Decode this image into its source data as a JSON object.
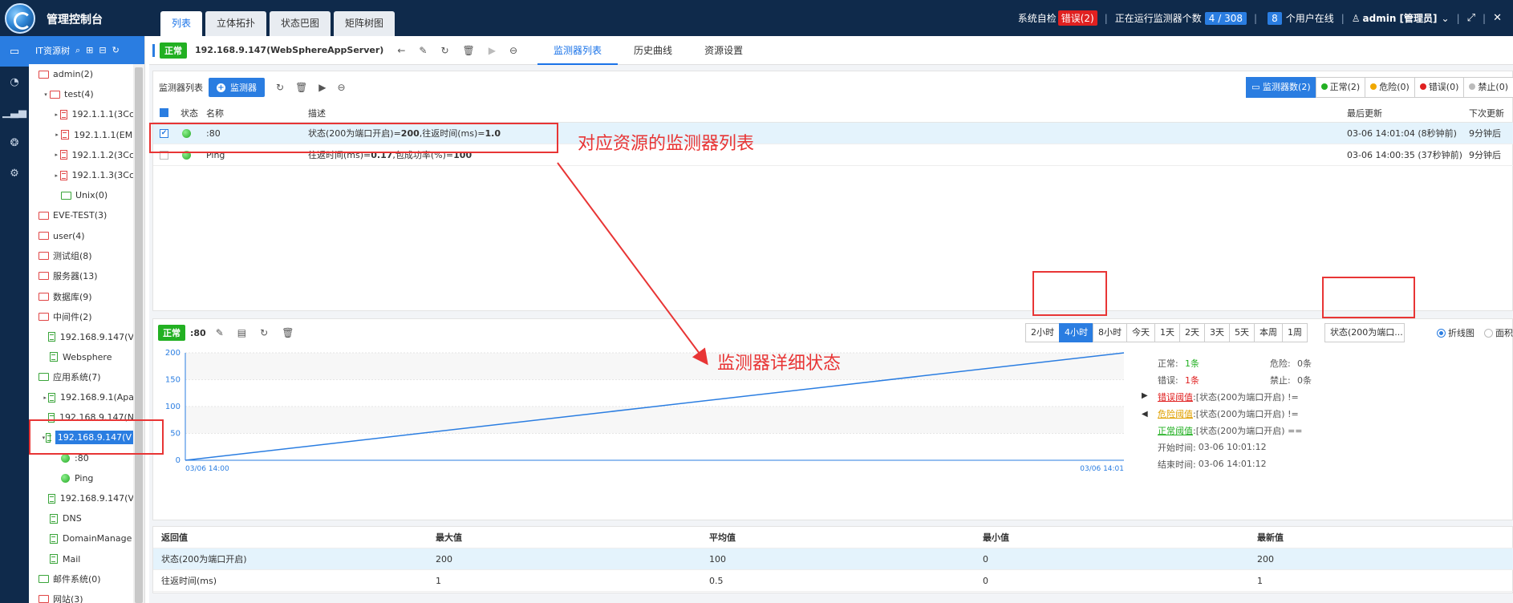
{
  "app": {
    "title": "管理控制台"
  },
  "top_tabs": [
    "列表",
    "立体拓扑",
    "状态巴图",
    "矩阵树图"
  ],
  "header": {
    "self_check_label": "系统自检",
    "self_check_status": "错误(2)",
    "running_label": "正在运行监测器个数",
    "running_count": "4 / 308",
    "online_count": "8",
    "online_label": "个用户在线",
    "user": "admin [管理员]"
  },
  "tree": {
    "header": "IT资源树",
    "nodes": [
      {
        "label": "admin(2)",
        "type": "folder-open",
        "caret": "",
        "indent": 0
      },
      {
        "label": "test(4)",
        "type": "folder-open",
        "caret": "▾",
        "indent": 1
      },
      {
        "label": "192.1.1.1(3Cc",
        "type": "doc",
        "caret": "▸",
        "indent": 2
      },
      {
        "label": "192.1.1.1(EM",
        "type": "doc",
        "caret": "▸",
        "indent": 2
      },
      {
        "label": "192.1.1.2(3Cc",
        "type": "doc",
        "caret": "▸",
        "indent": 2
      },
      {
        "label": "192.1.1.3(3Cc",
        "type": "doc",
        "caret": "▸",
        "indent": 2
      },
      {
        "label": "Unix(0)",
        "type": "folder-green",
        "caret": "",
        "indent": 2
      },
      {
        "label": "EVE-TEST(3)",
        "type": "folder",
        "caret": "",
        "indent": 0
      },
      {
        "label": "user(4)",
        "type": "folder",
        "caret": "",
        "indent": 0
      },
      {
        "label": "测试组(8)",
        "type": "folder",
        "caret": "",
        "indent": 0
      },
      {
        "label": "服务器(13)",
        "type": "folder",
        "caret": "",
        "indent": 0
      },
      {
        "label": "数据库(9)",
        "type": "folder",
        "caret": "",
        "indent": 0
      },
      {
        "label": "中间件(2)",
        "type": "folder-open",
        "caret": "",
        "indent": 0
      },
      {
        "label": "192.168.9.147(V",
        "type": "doc-green",
        "caret": "",
        "indent": 1
      },
      {
        "label": "Websphere",
        "type": "doc-green",
        "caret": "",
        "indent": 1
      },
      {
        "label": "应用系统(7)",
        "type": "folder-green",
        "caret": "",
        "indent": 0
      },
      {
        "label": "192.168.9.1(Apa",
        "type": "doc-green",
        "caret": "▸",
        "indent": 1
      },
      {
        "label": "192.168.9.147(N",
        "type": "doc-green",
        "caret": "",
        "indent": 1
      },
      {
        "label": "192.168.9.147(V",
        "type": "doc-green",
        "caret": "▾",
        "indent": 1,
        "selected": true
      },
      {
        "label": ":80",
        "type": "dot",
        "caret": "",
        "indent": 2
      },
      {
        "label": "Ping",
        "type": "dot",
        "caret": "",
        "indent": 2
      },
      {
        "label": "192.168.9.147(V",
        "type": "doc-green",
        "caret": "",
        "indent": 1
      },
      {
        "label": "DNS",
        "type": "doc-green",
        "caret": "",
        "indent": 1
      },
      {
        "label": "DomainManage",
        "type": "doc-green",
        "caret": "",
        "indent": 1
      },
      {
        "label": "Mail",
        "type": "doc-green",
        "caret": "",
        "indent": 1
      },
      {
        "label": "邮件系统(0)",
        "type": "folder-green",
        "caret": "",
        "indent": 0
      },
      {
        "label": "网站(3)",
        "type": "folder",
        "caret": "",
        "indent": 0
      }
    ]
  },
  "resource": {
    "status": "正常",
    "name": "192.168.9.147(WebSphereAppServer)",
    "sub_tabs": [
      "监测器列表",
      "历史曲线",
      "资源设置"
    ]
  },
  "monitor_list": {
    "title": "监测器列表",
    "add_button": "监测器",
    "filters": [
      "监测器数(2)",
      "正常(2)",
      "危险(0)",
      "错误(0)",
      "禁止(0)"
    ],
    "columns": [
      "状态",
      "名称",
      "描述",
      "最后更新",
      "下次更新"
    ],
    "rows": [
      {
        "checked": true,
        "name": ":80",
        "desc_prefix": "状态(200为端口开启)=",
        "desc_v1": "200",
        "desc_mid": ",往返时间(ms)=",
        "desc_v2": "1.0",
        "last_update": "03-06 14:01:04 (8秒钟前)",
        "next_update": "9分钟后"
      },
      {
        "checked": false,
        "name": "Ping",
        "desc_prefix": "往返时间(ms)=",
        "desc_v1": "0.17",
        "desc_mid": ",包成功率(%)=",
        "desc_v2": "100",
        "last_update": "03-06 14:00:35 (37秒钟前)",
        "next_update": "9分钟后"
      }
    ]
  },
  "detail": {
    "status": "正常",
    "name": ":80",
    "ranges": [
      "2小时",
      "4小时",
      "8小时",
      "今天",
      "1天",
      "2天",
      "3天",
      "5天",
      "本周",
      "1周"
    ],
    "active_range": "4小时",
    "metric": "状态(200为端口...",
    "chart_types": [
      "折线图",
      "面积"
    ],
    "info": {
      "normal_label": "正常:",
      "normal_val": "1条",
      "danger_label": "危险:",
      "danger_val": "0条",
      "error_label": "错误:",
      "error_val": "1条",
      "forbid_label": "禁止:",
      "forbid_val": "0条",
      "err_thr_label": "错误阈值",
      "err_thr_val": ":[状态(200为端口开启) !=",
      "dng_thr_label": "危险阈值",
      "dng_thr_val": ":[状态(200为端口开启) !=",
      "ok_thr_label": "正常阈值",
      "ok_thr_val": ":[状态(200为端口开启) ==",
      "start_label": "开始时间:",
      "start_val": "03-06 10:01:12",
      "end_label": "结束时间:",
      "end_val": "03-06 14:01:12"
    }
  },
  "chart_data": {
    "type": "line",
    "x": [
      "03/06 14:00",
      "03/06 14:01"
    ],
    "series": [
      {
        "values": [
          0,
          200
        ]
      }
    ],
    "yticks": [
      0,
      50,
      100,
      150,
      200
    ],
    "ylim": [
      0,
      200
    ],
    "xlabel": "",
    "ylabel": "",
    "grid": true,
    "colors": {
      "line": "#2a7de1",
      "grid": "#e6e6e6"
    }
  },
  "stats": {
    "columns": [
      "返回值",
      "最大值",
      "平均值",
      "最小值",
      "最新值"
    ],
    "rows": [
      [
        "状态(200为端口开启)",
        "200",
        "100",
        "0",
        "200"
      ],
      [
        "往返时间(ms)",
        "1",
        "0.5",
        "0",
        "1"
      ]
    ]
  },
  "annotations": {
    "list_label": "对应资源的监测器列表",
    "detail_label": "监测器详细状态"
  },
  "colors": {
    "accent": "#2a7de1",
    "header_bg": "#0f2a4b",
    "ok": "#22b022",
    "error": "#e02020",
    "annotation": "#e83535"
  }
}
